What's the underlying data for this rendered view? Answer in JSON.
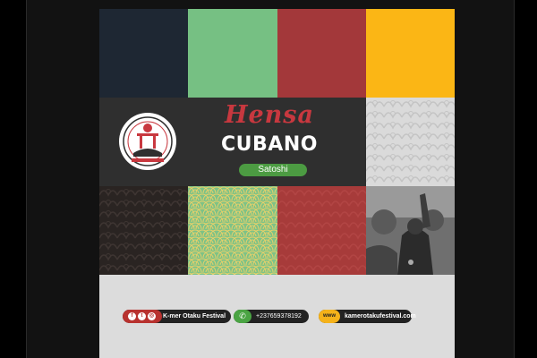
{
  "poster": {
    "title_script": "Hensa",
    "title_main": "CUBANO",
    "subtitle": "Satoshi"
  },
  "footer": {
    "social_name": "K-mer Otaku Festival",
    "phone": "+237659378192",
    "web_prefix": "www",
    "website": "kamerotakufestival.com"
  },
  "icons": [
    "facebook-icon",
    "twitter-icon",
    "instagram-icon",
    "whatsapp-icon"
  ],
  "colors": {
    "navy": "#1e2733",
    "green": "#76c083",
    "red": "#a3383a",
    "yellow": "#fbb615",
    "center_dark": "#2f2f2f",
    "script_red": "#c8383f",
    "pill_green": "#4c9b42"
  }
}
